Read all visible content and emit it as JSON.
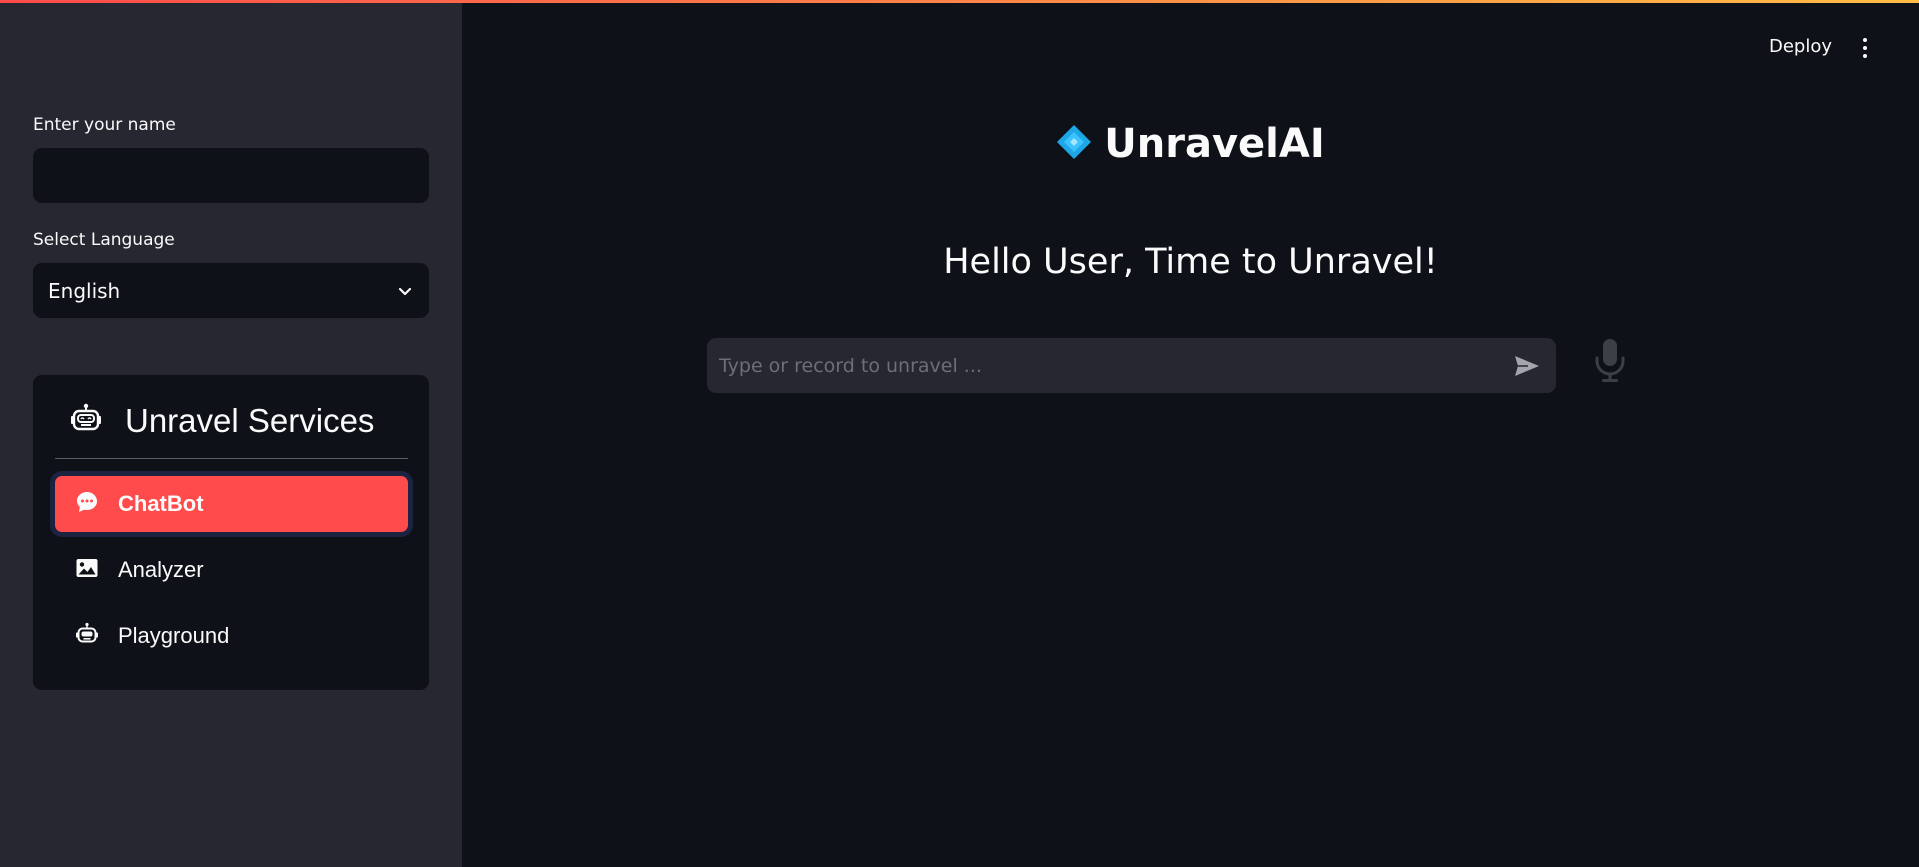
{
  "sidebar": {
    "name_label": "Enter your name",
    "name_value": "",
    "language_label": "Select Language",
    "language_value": "English",
    "services": {
      "title": "Unravel Services",
      "items": [
        {
          "label": "ChatBot",
          "icon": "chat-dots-icon",
          "active": true
        },
        {
          "label": "Analyzer",
          "icon": "image-icon",
          "active": false
        },
        {
          "label": "Playground",
          "icon": "robot-icon",
          "active": false
        }
      ]
    }
  },
  "header": {
    "deploy_label": "Deploy",
    "menu_icon": "kebab-menu-icon"
  },
  "main": {
    "app_title": "UnravelAI",
    "logo_icon": "diamond-logo-icon",
    "greeting": "Hello User, Time to Unravel!",
    "chat_placeholder": "Type or record to unravel ...",
    "send_icon": "send-icon",
    "mic_icon": "microphone-icon"
  },
  "colors": {
    "accent": "#ff4b4b",
    "background": "#0e1117",
    "sidebar": "#262730",
    "logo": "#1ea7e6"
  }
}
